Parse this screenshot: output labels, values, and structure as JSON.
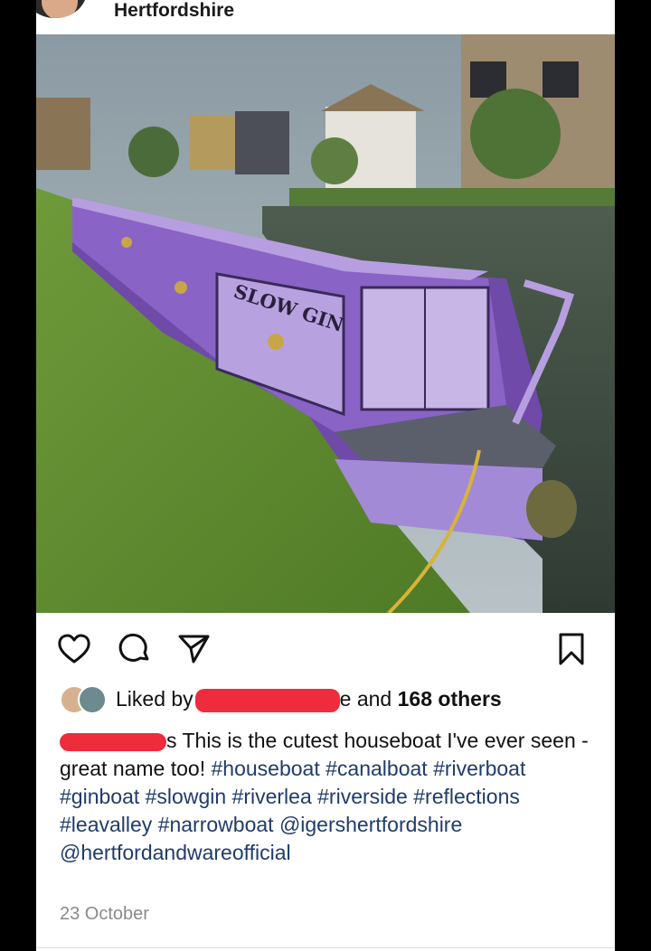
{
  "header": {
    "location": "Hertfordshire"
  },
  "photo": {
    "boat_name": "SLOW GIN"
  },
  "actions": {
    "like_icon": "heart-icon",
    "comment_icon": "comment-icon",
    "share_icon": "send-icon",
    "save_icon": "bookmark-icon"
  },
  "likes": {
    "prefix": "Liked by",
    "partial_name": "e and",
    "others": "168 others"
  },
  "caption": {
    "username_suffix": "s",
    "text": "This is the cutest houseboat I've ever seen - great name too!",
    "hashtags": [
      "#houseboat",
      "#canalboat",
      "#riverboat",
      "#ginboat",
      "#slowgin",
      "#riverlea",
      "#riverside",
      "#reflections",
      "#leavalley",
      "#narrowboat"
    ],
    "mentions": [
      "@igershertfordshire",
      "@hertfordandwareofficial"
    ]
  },
  "date": "23 October",
  "colors": {
    "hashtag": "#1f3c6b",
    "redaction": "#ee2c3c",
    "boat": "#8a63c7"
  }
}
